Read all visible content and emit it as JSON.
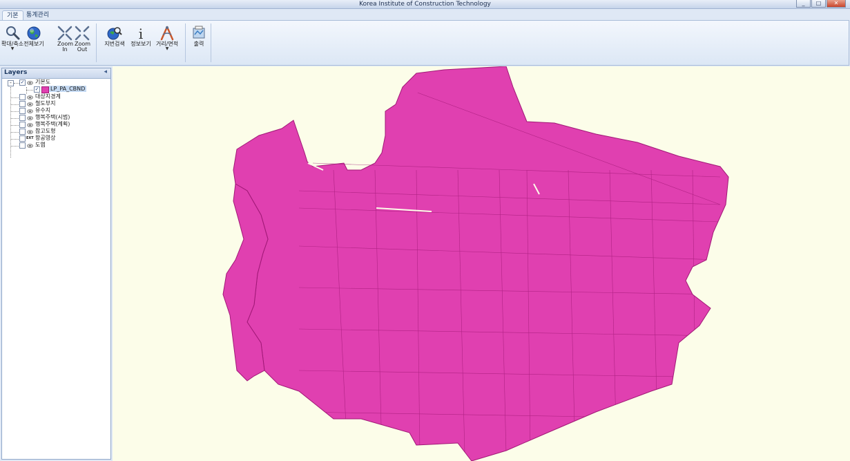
{
  "window": {
    "title": "Korea Institute of Construction Technology",
    "buttons": [
      "_",
      "□",
      "✕"
    ]
  },
  "ribbon_tabs": [
    {
      "label": "기본",
      "active": true
    },
    {
      "label": "통계관리",
      "active": false
    }
  ],
  "toolbar": {
    "zoom_label": "확대/축소",
    "full_view_label": "전체보기",
    "zoom_in_label": "Zoom In",
    "zoom_out_label": "Zoom Out",
    "parcel_search_label": "지번검색",
    "info_label": "정보보기",
    "measure_label": "거리/면적",
    "print_label": "출력"
  },
  "layers_panel": {
    "title": "Layers",
    "pin": "◂",
    "root": {
      "label": "기본도",
      "checked": true
    },
    "selected_layer": {
      "label": "LP_PA_CBND",
      "checked": true,
      "color": "#e040b0"
    },
    "items": [
      {
        "label": "대상지경계",
        "checked": false
      },
      {
        "label": "철도부지",
        "checked": false
      },
      {
        "label": "유수지",
        "checked": false
      },
      {
        "label": "행복주택(시범)",
        "checked": false
      },
      {
        "label": "행복주택(계획)",
        "checked": false
      },
      {
        "label": "참고도형",
        "checked": false
      },
      {
        "label": "항공영상",
        "checked": false,
        "ext": "EXT"
      },
      {
        "label": "도엽",
        "checked": false
      }
    ]
  },
  "map": {
    "background": "#fcfde9",
    "fill": "#e040b0",
    "stroke": "#a01876"
  }
}
